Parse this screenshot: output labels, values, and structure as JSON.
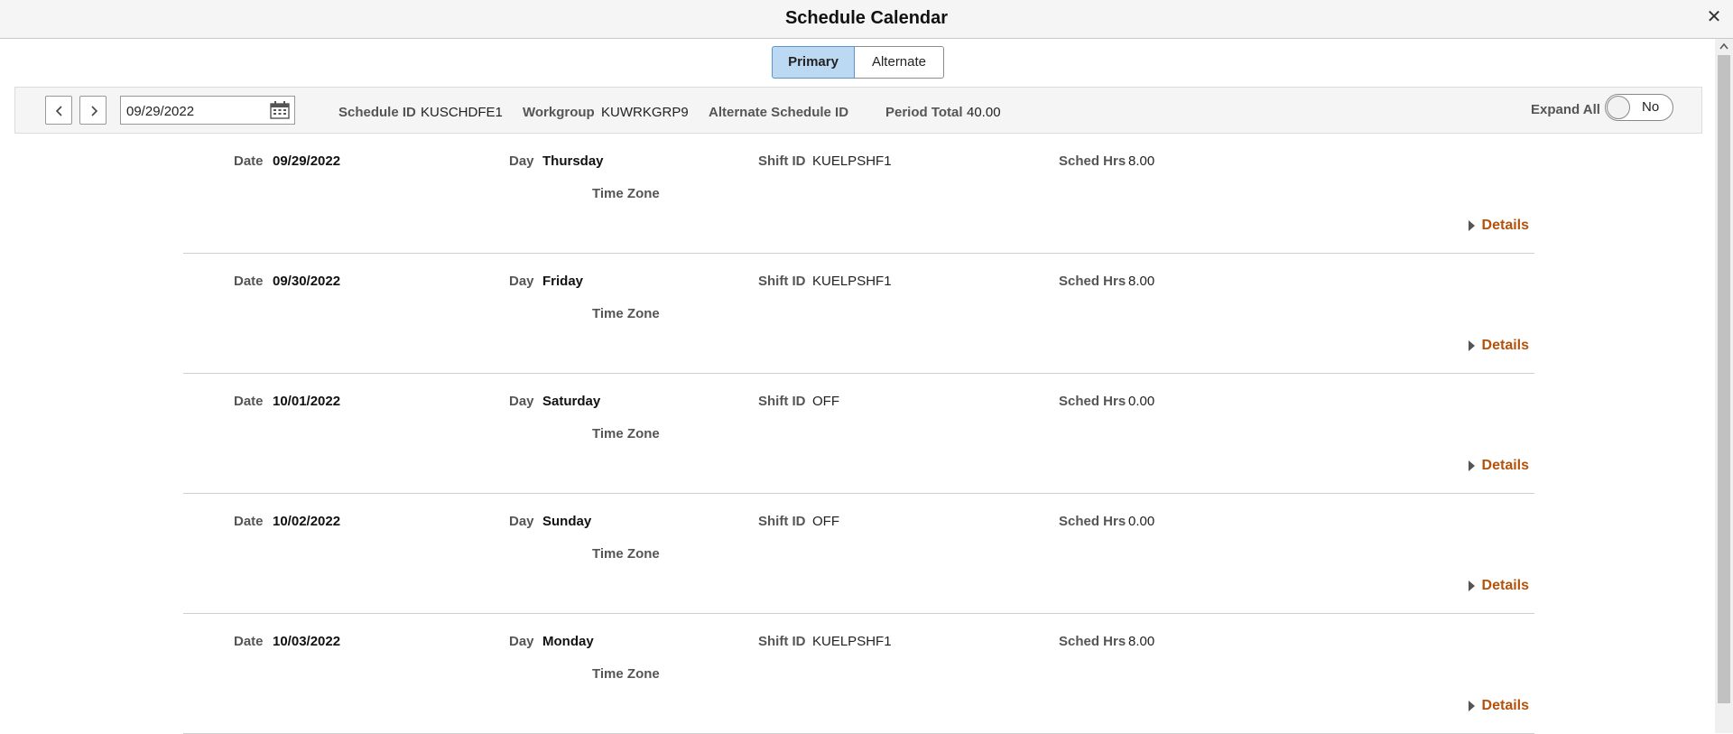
{
  "window": {
    "title": "Schedule Calendar"
  },
  "tabs": {
    "primary": "Primary",
    "alternate": "Alternate"
  },
  "header": {
    "date_value": "09/29/2022",
    "schedule_id_label": "Schedule ID",
    "schedule_id_value": "KUSCHDFE1",
    "workgroup_label": "Workgroup",
    "workgroup_value": "KUWRKGRP9",
    "alt_schedule_label": "Alternate Schedule ID",
    "period_total_label": "Period Total",
    "period_total_value": "40.00",
    "expand_all_label": "Expand All",
    "expand_all_value": "No"
  },
  "labels": {
    "date": "Date",
    "day": "Day",
    "shift_id": "Shift ID",
    "sched_hrs": "Sched Hrs",
    "time_zone": "Time Zone",
    "details": "Details"
  },
  "rows": [
    {
      "date": "09/29/2022",
      "day": "Thursday",
      "shift_id": "KUELPSHF1",
      "sched_hrs": "8.00"
    },
    {
      "date": "09/30/2022",
      "day": "Friday",
      "shift_id": "KUELPSHF1",
      "sched_hrs": "8.00"
    },
    {
      "date": "10/01/2022",
      "day": "Saturday",
      "shift_id": "OFF",
      "sched_hrs": "0.00"
    },
    {
      "date": "10/02/2022",
      "day": "Sunday",
      "shift_id": "OFF",
      "sched_hrs": "0.00"
    },
    {
      "date": "10/03/2022",
      "day": "Monday",
      "shift_id": "KUELPSHF1",
      "sched_hrs": "8.00"
    }
  ],
  "colors": {
    "accent_link": "#b5520b",
    "selected_tab": "#bcd9f3"
  }
}
